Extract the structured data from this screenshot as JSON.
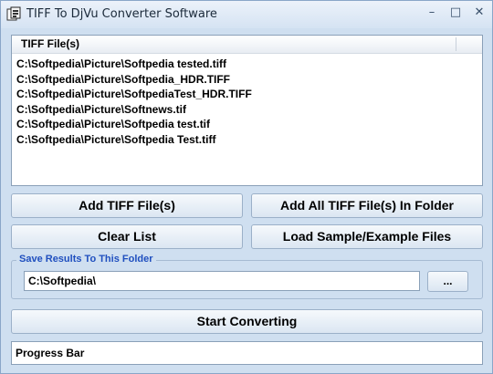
{
  "window": {
    "title": "TIFF To DjVu Converter Software",
    "controls": {
      "minimize": "–",
      "maximize": "□",
      "close": "✕"
    }
  },
  "file_list": {
    "header": "TIFF File(s)",
    "items": [
      "C:\\Softpedia\\Picture\\Softpedia tested.tiff",
      "C:\\Softpedia\\Picture\\Softpedia_HDR.TIFF",
      "C:\\Softpedia\\Picture\\SoftpediaTest_HDR.TIFF",
      "C:\\Softpedia\\Picture\\Softnews.tif",
      "C:\\Softpedia\\Picture\\Softpedia test.tif",
      "C:\\Softpedia\\Picture\\Softpedia Test.tiff"
    ]
  },
  "buttons": {
    "add_files": "Add TIFF File(s)",
    "add_folder": "Add All TIFF File(s) In Folder",
    "clear_list": "Clear List",
    "load_samples": "Load Sample/Example Files",
    "browse": "...",
    "start": "Start Converting"
  },
  "save_group": {
    "label": "Save Results To This Folder",
    "folder_value": "C:\\Softpedia\\"
  },
  "progress": {
    "label": "Progress Bar"
  },
  "icons": {
    "app": "app-icon"
  },
  "colors": {
    "window_bg": "#cfdff0",
    "group_label": "#1f4fbf"
  }
}
